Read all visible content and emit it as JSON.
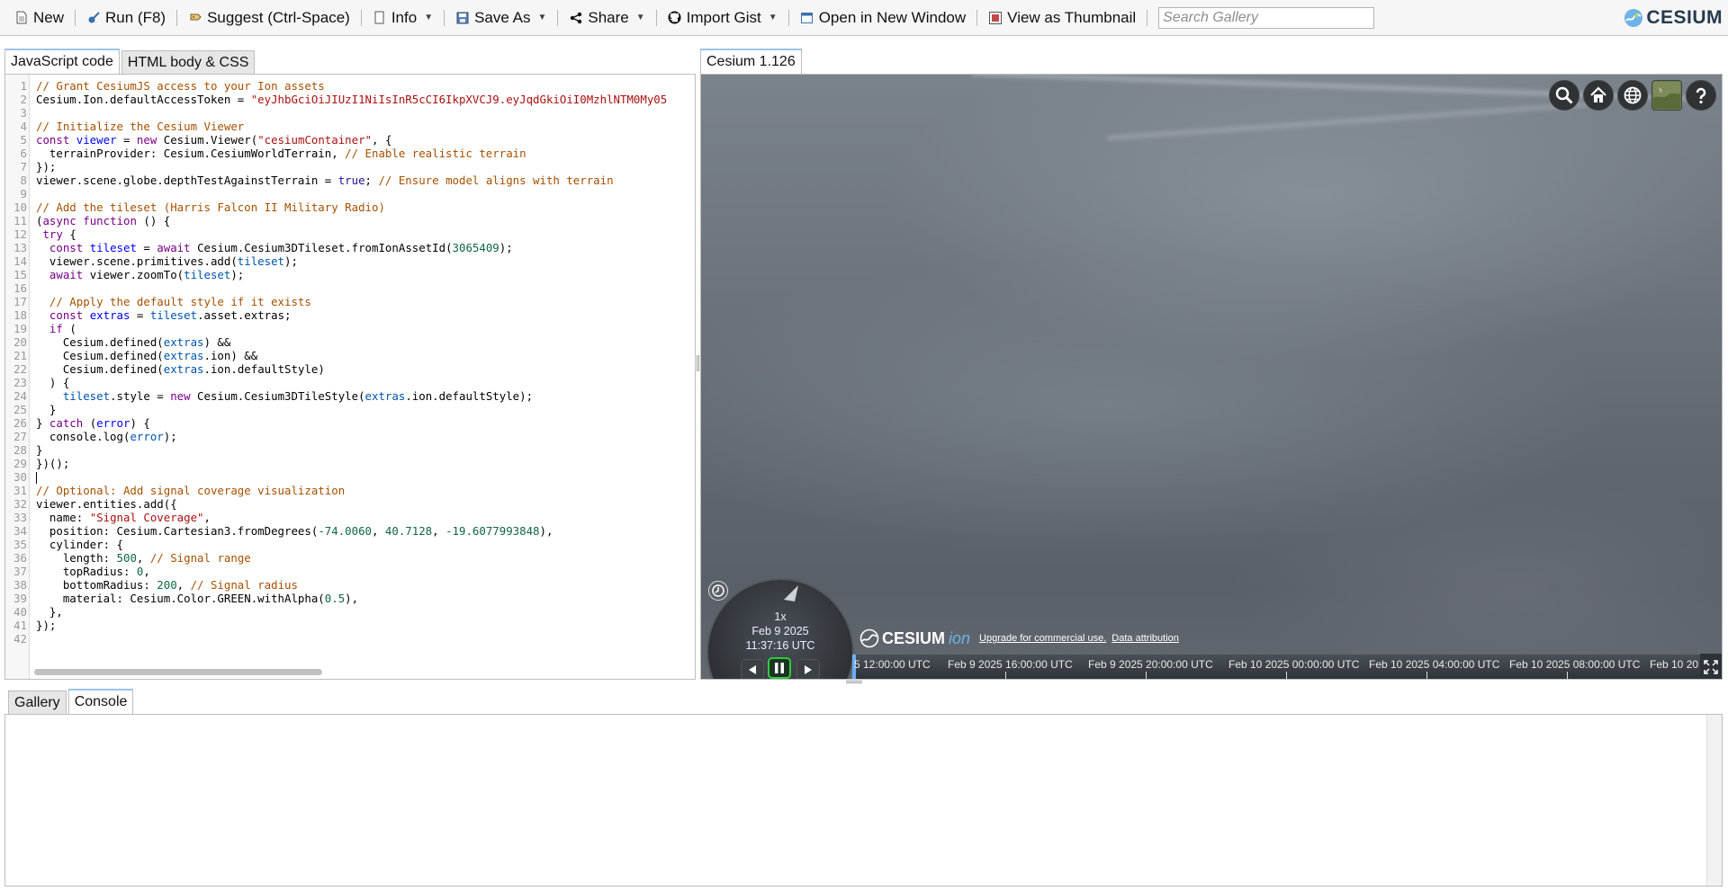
{
  "toolbar": {
    "new": "New",
    "run": "Run (F8)",
    "suggest": "Suggest (Ctrl-Space)",
    "info": "Info",
    "save_as": "Save As",
    "share": "Share",
    "import_gist": "Import Gist",
    "open_new_window": "Open in New Window",
    "view_thumbnail": "View as Thumbnail",
    "search_placeholder": "Search Gallery",
    "logo_text": "CESIUM"
  },
  "editor_tabs": {
    "js": "JavaScript code",
    "html": "HTML body & CSS"
  },
  "code_lines": [
    [
      [
        "// Grant CesiumJS access to your Ion assets",
        "cm"
      ]
    ],
    [
      [
        "Cesium.Ion.defaultAccessToken = ",
        ""
      ],
      [
        "\"eyJhbGciOiJIUzI1NiIsInR5cCI6IkpXVCJ9.eyJqdGkiOiI0MzhlNTM0My05",
        "st"
      ]
    ],
    [],
    [
      [
        "// Initialize the Cesium Viewer",
        "cm"
      ]
    ],
    [
      [
        "const ",
        "kw"
      ],
      [
        "viewer",
        "df"
      ],
      [
        " = ",
        ""
      ],
      [
        "new ",
        "kw"
      ],
      [
        "Cesium.Viewer(",
        ""
      ],
      [
        "\"cesiumContainer\"",
        "st"
      ],
      [
        ", {",
        ""
      ]
    ],
    [
      [
        "  terrainProvider: Cesium.CesiumWorldTerrain, ",
        ""
      ],
      [
        "// Enable realistic terrain",
        "cm"
      ]
    ],
    [
      [
        "});",
        ""
      ]
    ],
    [
      [
        "viewer.scene.globe.depthTestAgainstTerrain = ",
        ""
      ],
      [
        "true",
        "at"
      ],
      [
        "; ",
        ""
      ],
      [
        "// Ensure model aligns with terrain",
        "cm"
      ]
    ],
    [],
    [
      [
        "// Add the tileset (Harris Falcon II Military Radio)",
        "cm"
      ]
    ],
    [
      [
        "(",
        ""
      ],
      [
        "async ",
        "kw"
      ],
      [
        "function ",
        "kw"
      ],
      [
        "() {",
        ""
      ]
    ],
    [
      [
        " try ",
        "kw"
      ],
      [
        "{",
        ""
      ]
    ],
    [
      [
        "  ",
        ""
      ],
      [
        "const ",
        "kw"
      ],
      [
        "tileset",
        "df"
      ],
      [
        " = ",
        ""
      ],
      [
        "await ",
        "kw"
      ],
      [
        "Cesium.Cesium3DTileset.fromIonAssetId(",
        ""
      ],
      [
        "3065409",
        "nm"
      ],
      [
        ");",
        ""
      ]
    ],
    [
      [
        "  viewer.scene.primitives.add(",
        ""
      ],
      [
        "tileset",
        "vr"
      ],
      [
        ");",
        ""
      ]
    ],
    [
      [
        "  ",
        ""
      ],
      [
        "await ",
        "kw"
      ],
      [
        "viewer.zoomTo(",
        ""
      ],
      [
        "tileset",
        "vr"
      ],
      [
        ");",
        ""
      ]
    ],
    [],
    [
      [
        "  ",
        ""
      ],
      [
        "// Apply the default style if it exists",
        "cm"
      ]
    ],
    [
      [
        "  ",
        ""
      ],
      [
        "const ",
        "kw"
      ],
      [
        "extras",
        "df"
      ],
      [
        " = ",
        ""
      ],
      [
        "tileset",
        "vr"
      ],
      [
        ".asset.extras;",
        ""
      ]
    ],
    [
      [
        "  ",
        ""
      ],
      [
        "if ",
        "kw"
      ],
      [
        "(",
        ""
      ]
    ],
    [
      [
        "    Cesium.defined(",
        ""
      ],
      [
        "extras",
        "vr"
      ],
      [
        ") &&",
        ""
      ]
    ],
    [
      [
        "    Cesium.defined(",
        ""
      ],
      [
        "extras",
        "vr"
      ],
      [
        ".ion) &&",
        ""
      ]
    ],
    [
      [
        "    Cesium.defined(",
        ""
      ],
      [
        "extras",
        "vr"
      ],
      [
        ".ion.defaultStyle)",
        ""
      ]
    ],
    [
      [
        "  ) {",
        ""
      ]
    ],
    [
      [
        "    ",
        ""
      ],
      [
        "tileset",
        "vr"
      ],
      [
        ".style = ",
        ""
      ],
      [
        "new ",
        "kw"
      ],
      [
        "Cesium.Cesium3DTileStyle(",
        ""
      ],
      [
        "extras",
        "vr"
      ],
      [
        ".ion.defaultStyle);",
        ""
      ]
    ],
    [
      [
        "  }",
        ""
      ]
    ],
    [
      [
        "} ",
        ""
      ],
      [
        "catch ",
        "kw"
      ],
      [
        "(",
        ""
      ],
      [
        "error",
        "df"
      ],
      [
        ") {",
        ""
      ]
    ],
    [
      [
        "  console.log(",
        ""
      ],
      [
        "error",
        "vr"
      ],
      [
        ");",
        ""
      ]
    ],
    [
      [
        "}",
        ""
      ]
    ],
    [
      [
        "})();",
        ""
      ]
    ],
    [
      [
        "",
        "cursor"
      ]
    ],
    [
      [
        "// Optional: Add signal coverage visualization",
        "cm"
      ]
    ],
    [
      [
        "viewer.entities.add({",
        ""
      ]
    ],
    [
      [
        "  name: ",
        ""
      ],
      [
        "\"Signal Coverage\"",
        "st"
      ],
      [
        ",",
        ""
      ]
    ],
    [
      [
        "  position: Cesium.Cartesian3.fromDegrees(",
        ""
      ],
      [
        "-74.0060",
        "nm"
      ],
      [
        ", ",
        ""
      ],
      [
        "40.7128",
        "nm"
      ],
      [
        ", ",
        ""
      ],
      [
        "-19.6077993848",
        "nm"
      ],
      [
        "),",
        ""
      ]
    ],
    [
      [
        "  cylinder: {",
        ""
      ]
    ],
    [
      [
        "    length: ",
        ""
      ],
      [
        "500",
        "nm"
      ],
      [
        ", ",
        ""
      ],
      [
        "// Signal range",
        "cm"
      ]
    ],
    [
      [
        "    topRadius: ",
        ""
      ],
      [
        "0",
        "nm"
      ],
      [
        ",",
        ""
      ]
    ],
    [
      [
        "    bottomRadius: ",
        ""
      ],
      [
        "200",
        "nm"
      ],
      [
        ", ",
        ""
      ],
      [
        "// Signal radius",
        "cm"
      ]
    ],
    [
      [
        "    material: Cesium.Color.GREEN.withAlpha(",
        ""
      ],
      [
        "0.5",
        "nm"
      ],
      [
        "),",
        ""
      ]
    ],
    [
      [
        "  },",
        ""
      ]
    ],
    [
      [
        "});",
        ""
      ]
    ],
    []
  ],
  "viewer": {
    "tab": "Cesium 1.126",
    "animation": {
      "speed": "1x",
      "date": "Feb 9 2025",
      "time": "11:37:16 UTC"
    },
    "credit": {
      "wordmark": "CESIUM",
      "ion": "ion",
      "upgrade": "Upgrade for commercial use.",
      "attribution": "Data attribution"
    },
    "timeline_labels": [
      "5 12:00:00 UTC",
      "Feb 9 2025 16:00:00 UTC",
      "Feb 9 2025 20:00:00 UTC",
      "Feb 10 2025 00:00:00 UTC",
      "Feb 10 2025 04:00:00 UTC",
      "Feb 10 2025 08:00:00 UTC",
      "Feb 10 20"
    ]
  },
  "bottom_tabs": {
    "gallery": "Gallery",
    "console": "Console"
  },
  "colors": {
    "accent_tab": "#9ec4ea",
    "play_green": "#2ecc40",
    "ion_blue": "#6db3e6"
  }
}
